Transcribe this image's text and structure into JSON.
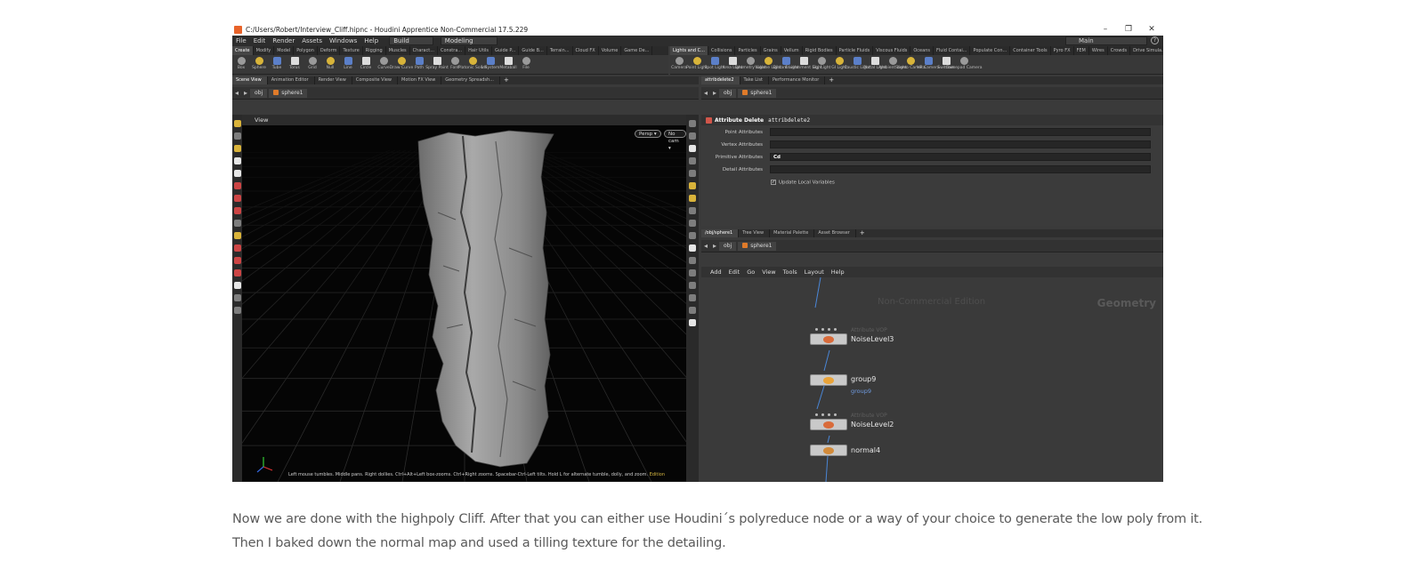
{
  "window": {
    "title": "C:/Users/Robert/Interview_Cliff.hipnc - Houdini Apprentice Non-Commercial 17.5.229",
    "controls": [
      "–",
      "❐",
      "✕"
    ]
  },
  "menu": {
    "items": [
      "File",
      "Edit",
      "Render",
      "Assets",
      "Windows",
      "Help"
    ],
    "build": "Build",
    "desktop": "Modeling",
    "main": "Main"
  },
  "shelf_tabs_left": [
    "Create",
    "Modify",
    "Model",
    "Polygon",
    "Deform",
    "Texture",
    "Rigging",
    "Muscles",
    "Charact...",
    "Constra...",
    "Hair Utils",
    "Guide P...",
    "Guide B...",
    "Terrain...",
    "Cloud FX",
    "Volume",
    "Game De..."
  ],
  "shelf_tabs_right": [
    "Lights and C...",
    "Collisions",
    "Particles",
    "Grains",
    "Vellum",
    "Rigid Bodies",
    "Particle Fluids",
    "Viscous Fluids",
    "Oceans",
    "Fluid Contai...",
    "Populate Con...",
    "Container Tools",
    "Pyro FX",
    "FEM",
    "Wires",
    "Crowds",
    "Drive Simula..."
  ],
  "tools_left": [
    {
      "label": "Box",
      "icon": "box-icon"
    },
    {
      "label": "Sphere",
      "icon": "sphere-icon"
    },
    {
      "label": "Tube",
      "icon": "tube-icon"
    },
    {
      "label": "Torus",
      "icon": "torus-icon"
    },
    {
      "label": "Grid",
      "icon": "grid-icon"
    },
    {
      "label": "Null",
      "icon": "null-icon"
    },
    {
      "label": "Line",
      "icon": "line-icon"
    },
    {
      "label": "Circle",
      "icon": "circle-icon"
    },
    {
      "label": "Curve",
      "icon": "curve-icon"
    },
    {
      "label": "Draw Curve",
      "icon": "draw-curve-icon"
    },
    {
      "label": "Path",
      "icon": "path-icon"
    },
    {
      "label": "Spray Paint",
      "icon": "spray-paint-icon"
    },
    {
      "label": "Font",
      "icon": "font-icon"
    },
    {
      "label": "Platonic Solids",
      "icon": "platonic-icon"
    },
    {
      "label": "L-System",
      "icon": "lsystem-icon"
    },
    {
      "label": "Metaball",
      "icon": "metaball-icon"
    },
    {
      "label": "File",
      "icon": "file-icon"
    }
  ],
  "tools_right": [
    {
      "label": "Camera",
      "icon": "camera-icon"
    },
    {
      "label": "Point Light",
      "icon": "point-light-icon"
    },
    {
      "label": "Spot Light",
      "icon": "spot-light-icon"
    },
    {
      "label": "Area Light",
      "icon": "area-light-icon"
    },
    {
      "label": "Geometry Light",
      "icon": "geometry-light-icon"
    },
    {
      "label": "Volume Light",
      "icon": "volume-light-icon"
    },
    {
      "label": "Distant Light",
      "icon": "distant-light-icon"
    },
    {
      "label": "Environment Light",
      "icon": "environment-light-icon"
    },
    {
      "label": "Sky Light",
      "icon": "sky-light-icon"
    },
    {
      "label": "GI Light",
      "icon": "gi-light-icon"
    },
    {
      "label": "Caustic Light",
      "icon": "caustic-light-icon"
    },
    {
      "label": "Portal Light",
      "icon": "portal-light-icon"
    },
    {
      "label": "Ambient Light",
      "icon": "ambient-light-icon"
    },
    {
      "label": "Stereo Camera",
      "icon": "stereo-camera-icon"
    },
    {
      "label": "VR Camera",
      "icon": "vr-camera-icon"
    },
    {
      "label": "Switcher",
      "icon": "switcher-icon"
    },
    {
      "label": "Gamepad Camera",
      "icon": "gamepad-camera-icon"
    }
  ],
  "left_pane_tabs": [
    "Scene View",
    "Animation Editor",
    "Render View",
    "Composite View",
    "Motion FX View",
    "Geometry Spreadsh..."
  ],
  "right_top_tabs": [
    "attribdelete2",
    "Take List",
    "Performance Monitor"
  ],
  "right_bottom_tabs": [
    "/obj/sphere1",
    "Tree View",
    "Material Palette",
    "Asset Browser"
  ],
  "path": {
    "obj": "obj",
    "node": "sphere1"
  },
  "viewport": {
    "label": "View",
    "persp": "Persp ▾",
    "cam": "No cam ▾",
    "status": "Left mouse tumbles. Middle pans. Right dollies. Ctrl+Alt+Left box-zooms. Ctrl+Right zooms. Spacebar-Ctrl-Left tilts. Hold L for alternate tumble, dolly, and zoom.",
    "status_edition": "Edition"
  },
  "params": {
    "type": "Attribute Delete",
    "name": "attribdelete2",
    "rows": [
      {
        "label": "Point Attributes",
        "value": ""
      },
      {
        "label": "Vertex Attributes",
        "value": ""
      },
      {
        "label": "Primitive Attributes",
        "value": "Cd"
      },
      {
        "label": "Detail Attributes",
        "value": ""
      }
    ],
    "checkbox": "Update Local Variables"
  },
  "network": {
    "menu": [
      "Add",
      "Edit",
      "Go",
      "View",
      "Tools",
      "Layout",
      "Help"
    ],
    "watermark": "Non-Commercial Edition",
    "context": "Geometry",
    "nodes": [
      {
        "name": "NoiseLevel3",
        "type": "Attribute VOP",
        "sub": "",
        "color": "#d96b3a"
      },
      {
        "name": "group9",
        "type": "",
        "sub": "group9",
        "color": "#e8a33a"
      },
      {
        "name": "NoiseLevel2",
        "type": "Attribute VOP",
        "sub": "",
        "color": "#d96b3a"
      },
      {
        "name": "normal4",
        "type": "",
        "sub": "",
        "color": "#d18a3a"
      }
    ]
  },
  "caption": {
    "line1": "Now we are done with the highpoly Cliff. After that you can either use Houdini´s polyreduce node or a way of your choice to generate the low poly from it.",
    "line2": "Then I baked down the normal map and used a tilling texture for the detailing."
  },
  "colors": {
    "houdini_orange": "#e8632a",
    "node_link": "#4a86d6",
    "edition_yellow": "#d6b640"
  }
}
